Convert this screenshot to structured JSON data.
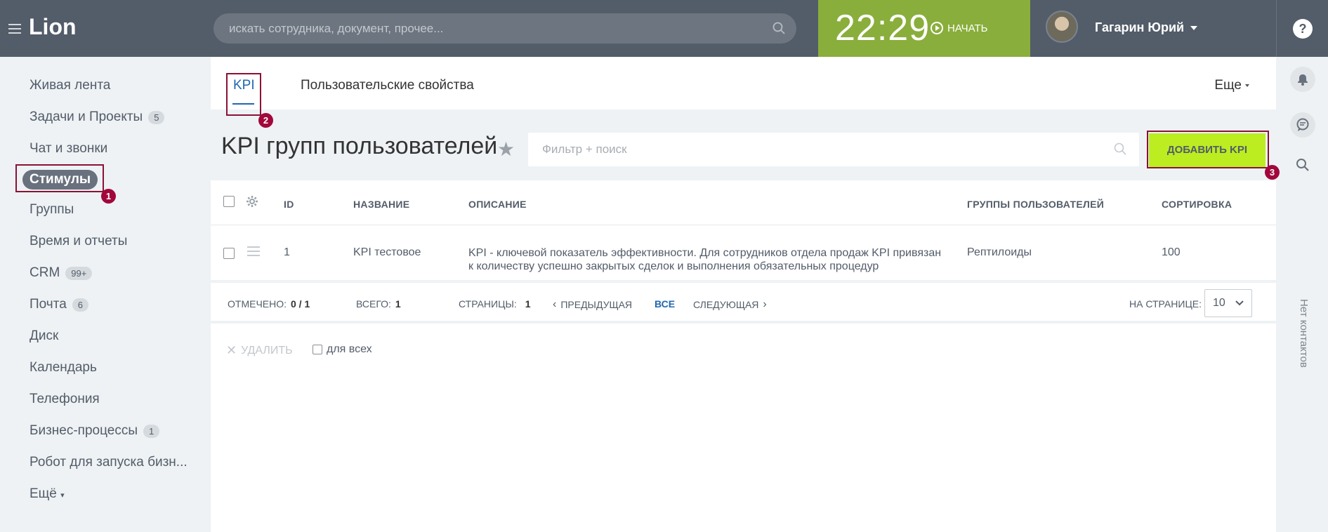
{
  "header": {
    "logo": "Lion",
    "search_placeholder": "искать сотрудника, документ, прочее...",
    "clock": "22:29",
    "start_label": "НАЧАТЬ",
    "user_name": "Гагарин Юрий",
    "help_label": "?"
  },
  "sidebar": {
    "items": [
      {
        "label": "Живая лента",
        "counter": ""
      },
      {
        "label": "Задачи и Проекты",
        "counter": "5"
      },
      {
        "label": "Чат и звонки",
        "counter": ""
      },
      {
        "label": "Стимулы",
        "counter": ""
      },
      {
        "label": "Группы",
        "counter": ""
      },
      {
        "label": "Время и отчеты",
        "counter": ""
      },
      {
        "label": "CRM",
        "counter": "99+"
      },
      {
        "label": "Почта",
        "counter": "6"
      },
      {
        "label": "Диск",
        "counter": ""
      },
      {
        "label": "Календарь",
        "counter": ""
      },
      {
        "label": "Телефония",
        "counter": ""
      },
      {
        "label": "Бизнес-процессы",
        "counter": "1"
      },
      {
        "label": "Робот для запуска бизн...",
        "counter": ""
      }
    ],
    "more_label": "Ещё"
  },
  "tabs": {
    "kpi": "KPI",
    "props": "Пользовательские свойства",
    "more": "Еще"
  },
  "toolbar": {
    "title": "KPI групп пользователей",
    "filter_placeholder": "Фильтр + поиск",
    "add_button": "ДОБАВИТЬ KPI"
  },
  "table": {
    "columns": {
      "id": "ID",
      "name": "НАЗВАНИЕ",
      "desc": "ОПИСАНИЕ",
      "groups": "ГРУППЫ ПОЛЬЗОВАТЕЛЕЙ",
      "sort": "СОРТИРОВКА"
    },
    "rows": [
      {
        "id": "1",
        "name": "KPI тестовое",
        "desc": "KPI - ключевой показатель эффективности. Для сотрудников отдела продаж KPI привязан к количеству успешно закрытых сделок и выполнения обязательных процедур",
        "groups": "Рептилоиды",
        "sort": "100"
      }
    ]
  },
  "pager": {
    "marked_label": "ОТМЕЧЕНО:",
    "marked_value": "0 / 1",
    "total_label": "ВСЕГО:",
    "total_value": "1",
    "pages_label": "СТРАНИЦЫ:",
    "pages_value": "1",
    "prev": "ПРЕДЫДУЩАЯ",
    "all": "ВСЕ",
    "next": "СЛЕДУЮЩАЯ",
    "per_page_label": "НА СТРАНИЦЕ:",
    "per_page_value": "10"
  },
  "actions": {
    "delete": "УДАЛИТЬ",
    "for_all": "для всех"
  },
  "rightpanel": {
    "no_contacts": "Нет контактов"
  },
  "annotations": [
    "1",
    "2",
    "3"
  ],
  "colors": {
    "header_bg": "#535c69",
    "timer_bg": "#89ae3b",
    "add_button_bg": "#bbed21",
    "highlight": "#8a1235",
    "badge": "#a2073b"
  }
}
